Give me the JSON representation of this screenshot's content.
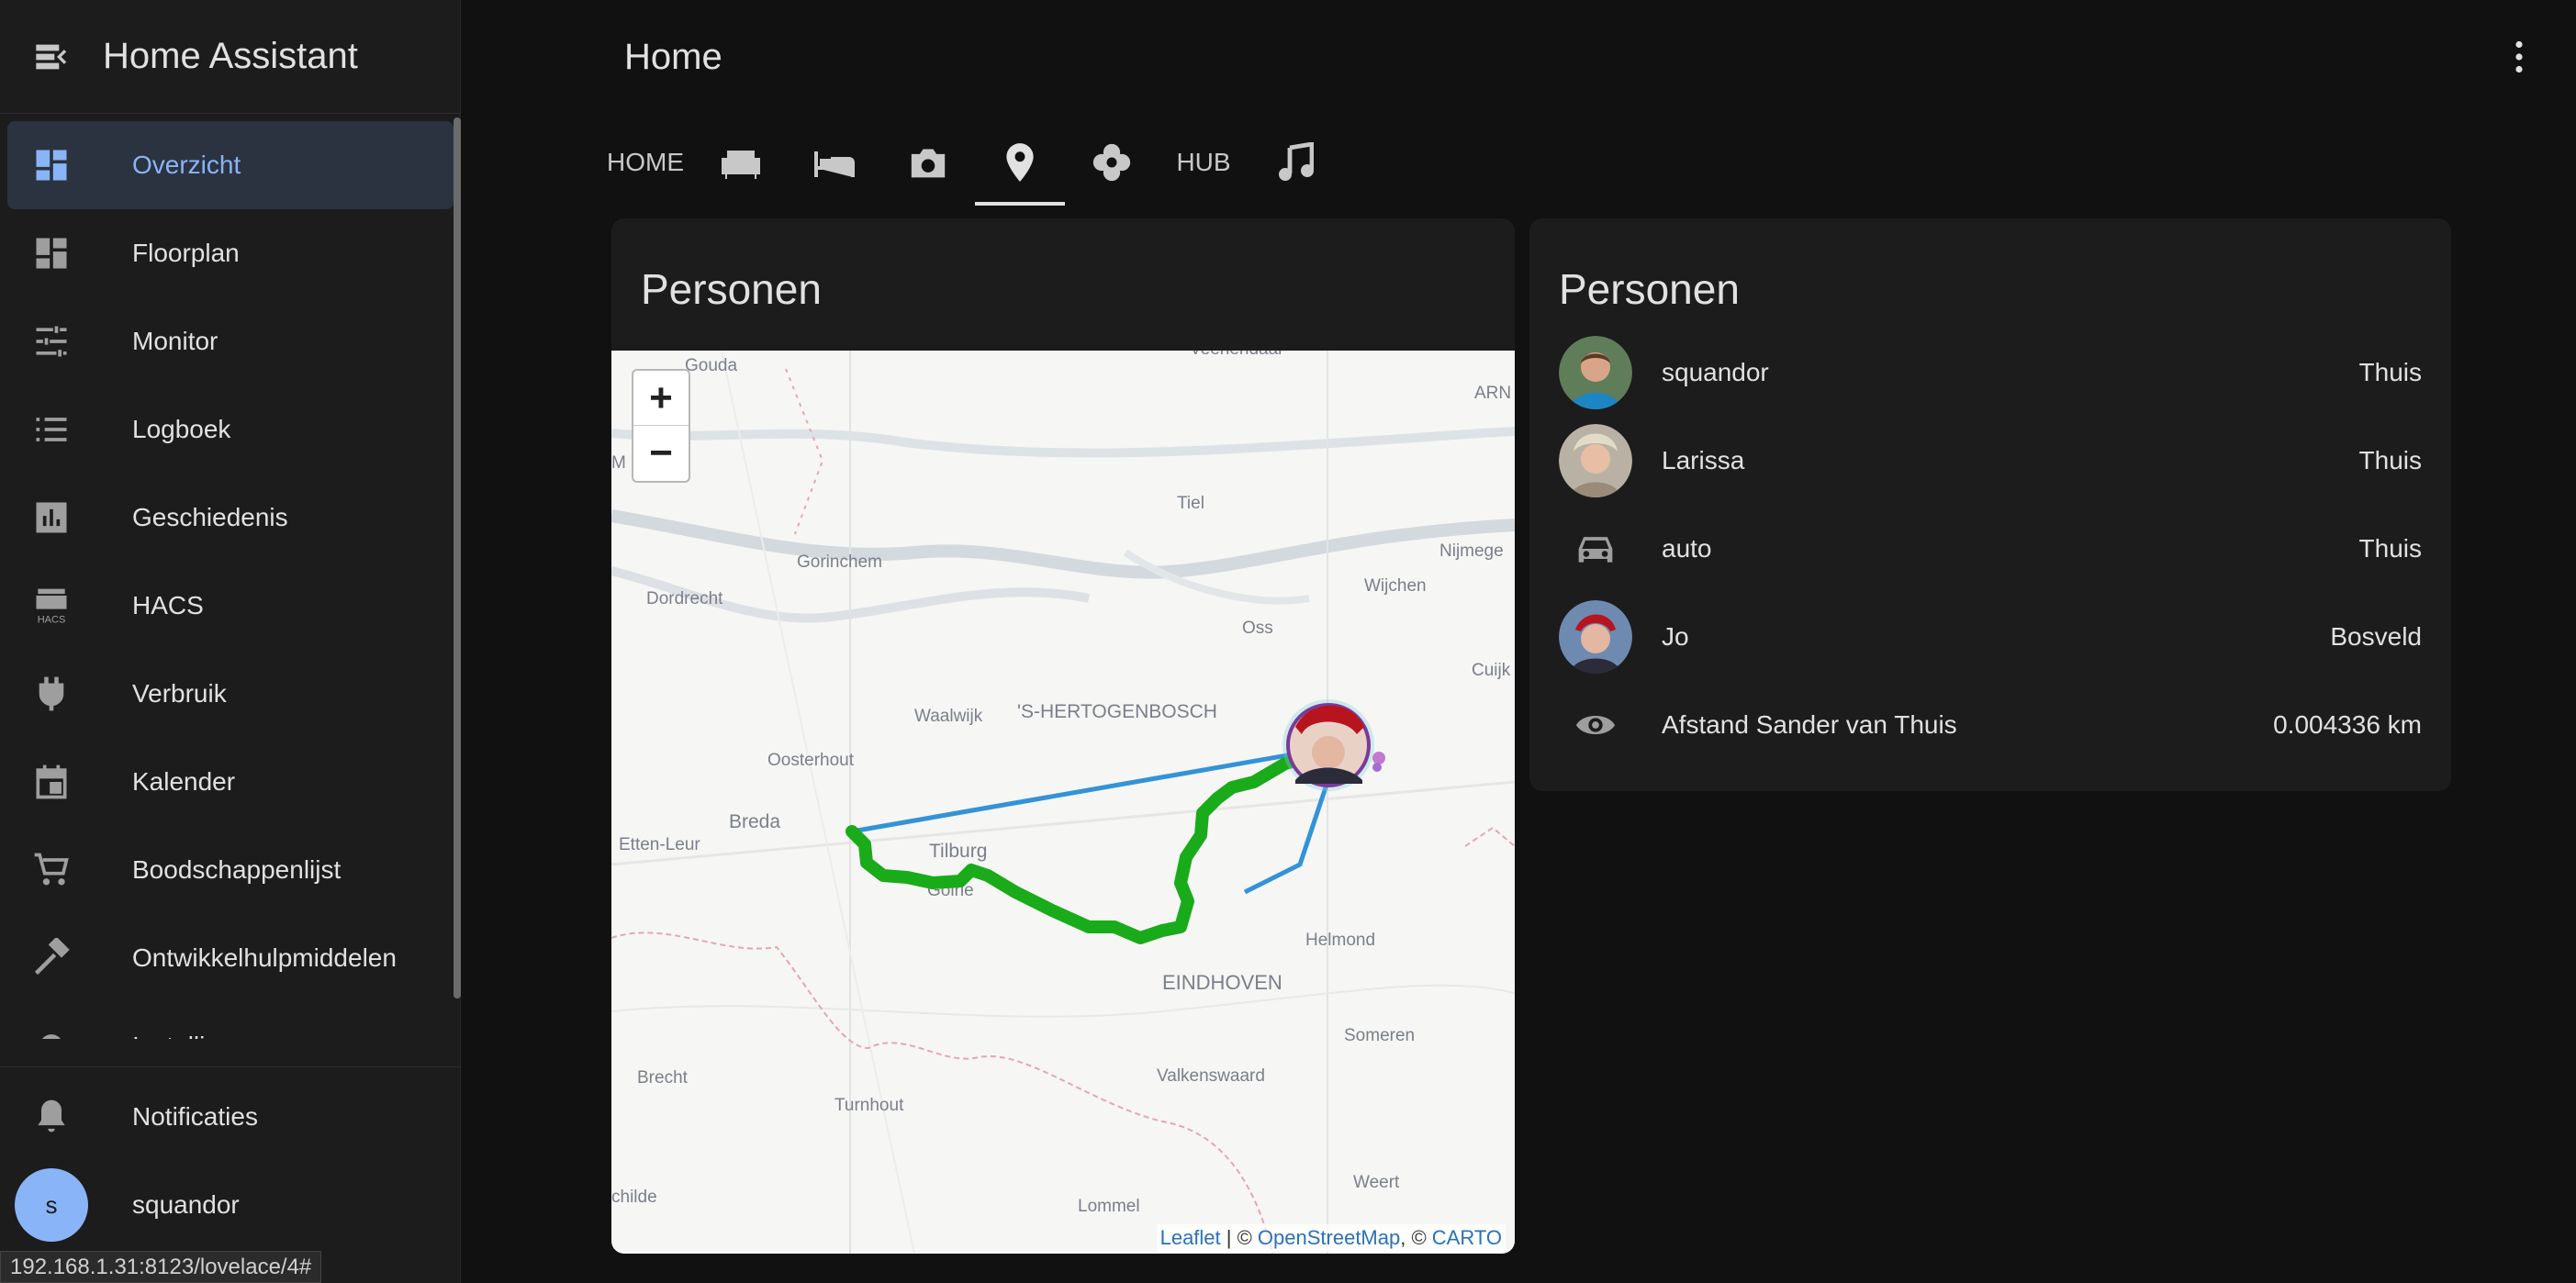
{
  "sidebar": {
    "title": "Home Assistant",
    "items": [
      {
        "label": "Overzicht",
        "icon": "dashboard-icon"
      },
      {
        "label": "Floorplan",
        "icon": "dashboard-icon"
      },
      {
        "label": "Monitor",
        "icon": "tune-icon"
      },
      {
        "label": "Logboek",
        "icon": "list-icon"
      },
      {
        "label": "Geschiedenis",
        "icon": "chart-bar-icon"
      },
      {
        "label": "HACS",
        "icon": "hacs-icon"
      },
      {
        "label": "Verbruik",
        "icon": "plug-icon"
      },
      {
        "label": "Kalender",
        "icon": "calendar-icon"
      },
      {
        "label": "Boodschappenlijst",
        "icon": "cart-icon"
      },
      {
        "label": "Ontwikkelhulpmiddelen",
        "icon": "hammer-icon"
      },
      {
        "label": "Instellingen",
        "icon": "cog-icon"
      }
    ],
    "notifications_label": "Notificaties",
    "user_label": "squandor",
    "user_initial": "s"
  },
  "status_url": "192.168.1.31:8123/lovelace/4#",
  "header": {
    "title": "Home"
  },
  "tabs": [
    {
      "label": "HOME",
      "icon": null
    },
    {
      "label": "",
      "icon": "sofa-icon"
    },
    {
      "label": "",
      "icon": "bed-icon"
    },
    {
      "label": "",
      "icon": "camera-icon"
    },
    {
      "label": "",
      "icon": "map-marker-icon",
      "active": true
    },
    {
      "label": "",
      "icon": "flower-icon"
    },
    {
      "label": "HUB",
      "icon": null
    },
    {
      "label": "",
      "icon": "music-note-icon"
    }
  ],
  "map_card": {
    "title": "Personen",
    "zoom_in": "+",
    "zoom_out": "−",
    "attribution": {
      "leaflet": "Leaflet",
      "sep1": " | © ",
      "osm": "OpenStreetMap",
      "sep2": ", © ",
      "carto": "CARTO"
    },
    "places": [
      "Gouda",
      "Veenendaal",
      "ARN",
      "Tiel",
      "Nijmege",
      "Gorinchem",
      "Dordrecht",
      "Wijchen",
      "Oss",
      "Cuijk",
      "'S-HERTOGENBOSCH",
      "Waalwijk",
      "Oosterhout",
      "Breda",
      "Etten-Leur",
      "Tilburg",
      "Goirle",
      "Helmond",
      "EINDHOVEN",
      "Someren",
      "Brecht",
      "Turnhout",
      "Valkenswaard",
      "Weert",
      "Lommel",
      "childe",
      "M"
    ]
  },
  "entities_card": {
    "title": "Personen",
    "rows": [
      {
        "name": "squandor",
        "state": "Thuis",
        "icon": "person-photo"
      },
      {
        "name": "Larissa",
        "state": "Thuis",
        "icon": "person-photo"
      },
      {
        "name": "auto",
        "state": "Thuis",
        "icon": "car-icon"
      },
      {
        "name": "Jo",
        "state": "Bosveld",
        "icon": "person-photo"
      },
      {
        "name": "Afstand Sander van Thuis",
        "state": "0.004336 km",
        "icon": "eye-icon"
      }
    ]
  }
}
